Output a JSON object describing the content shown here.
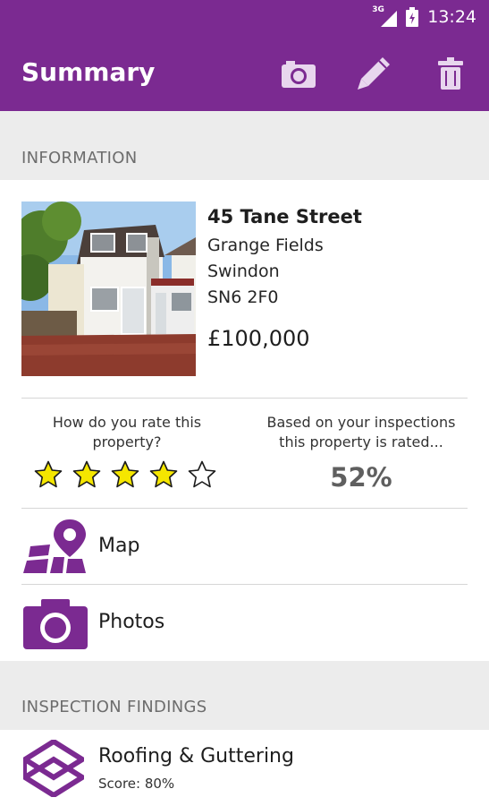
{
  "status_bar": {
    "network": "3G",
    "time": "13:24"
  },
  "app_bar": {
    "title": "Summary",
    "actions": [
      "camera-icon",
      "pencil-icon",
      "trash-icon"
    ]
  },
  "colors": {
    "primary": "#7b2a91",
    "star_fill": "#f5e600",
    "section_bg": "#ececec"
  },
  "information": {
    "header": "INFORMATION",
    "address": {
      "street": "45 Tane Street",
      "area": "Grange Fields",
      "town": "Swindon",
      "postcode": "SN6 2F0"
    },
    "price": "£100,000",
    "user_rating": {
      "question": "How do you rate this property?",
      "stars": 4,
      "max_stars": 5
    },
    "inspection_rating": {
      "label": "Based on your inspections this property is rated...",
      "value": "52%"
    },
    "links": [
      {
        "label": "Map",
        "icon": "map-pin-icon"
      },
      {
        "label": "Photos",
        "icon": "camera-icon"
      }
    ]
  },
  "findings": {
    "header": "INSPECTION FINDINGS",
    "items": [
      {
        "title": "Roofing & Guttering",
        "score": "Score: 80%",
        "icon": "roof-icon"
      }
    ]
  }
}
